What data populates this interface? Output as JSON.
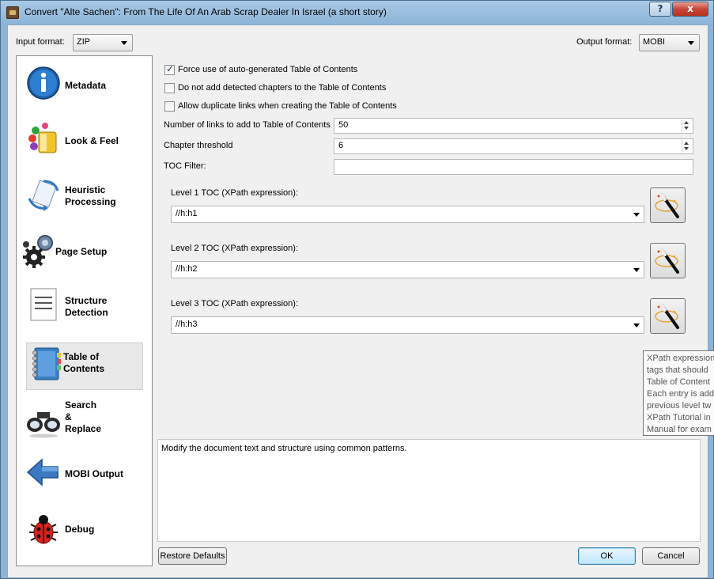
{
  "window": {
    "title": "Convert \"Alte Sachen\": From The Life Of An Arab Scrap Dealer In Israel (a short story)",
    "help_button": "?",
    "close_button": "x"
  },
  "formats": {
    "input_label": "Input format:",
    "input_value": "ZIP",
    "output_label": "Output format:",
    "output_value": "MOBI"
  },
  "sidebar": {
    "items": [
      {
        "label": "Metadata",
        "icon": "info-icon"
      },
      {
        "label": "Look & Feel",
        "icon": "paint-bucket-icon"
      },
      {
        "label": "Heuristic\nProcessing",
        "icon": "heuristics-icon"
      },
      {
        "label": "Page Setup",
        "icon": "gears-icon"
      },
      {
        "label": "Structure\nDetection",
        "icon": "document-lines-icon"
      },
      {
        "label": "Table of\nContents",
        "icon": "notebook-icon",
        "selected": true
      },
      {
        "label": "Search\n&\nReplace",
        "icon": "binoculars-icon"
      },
      {
        "label": "MOBI Output",
        "icon": "arrow-left-icon"
      },
      {
        "label": "Debug",
        "icon": "ladybug-icon"
      }
    ]
  },
  "toc": {
    "force_auto_label": "Force use of auto-generated Table of Contents",
    "force_auto_checked": true,
    "no_chapters_label": "Do not add detected chapters to the Table of Contents",
    "no_chapters_checked": false,
    "dup_links_label": "Allow duplicate links when creating the Table of Contents",
    "dup_links_checked": false,
    "num_links_label": "Number of links to add to Table of Contents",
    "num_links_value": "50",
    "chapter_threshold_label": "Chapter threshold",
    "chapter_threshold_value": "6",
    "toc_filter_label": "TOC Filter:",
    "toc_filter_value": "",
    "level1_label": "Level 1 TOC (XPath expression):",
    "level1_value": "//h:h1",
    "level2_label": "Level 2 TOC (XPath expression):",
    "level2_value": "//h:h2",
    "level3_label": "Level 3 TOC (XPath expression):",
    "level3_value": "//h:h3"
  },
  "tooltip": {
    "lines": [
      "XPath expression",
      "tags that should",
      "Table of Content",
      "Each entry is add",
      "previous level tw",
      "XPath Tutorial in",
      "Manual for exam"
    ]
  },
  "help_text": "Modify the document text and structure using common patterns.",
  "buttons": {
    "restore": "Restore Defaults",
    "ok": "OK",
    "cancel": "Cancel"
  }
}
